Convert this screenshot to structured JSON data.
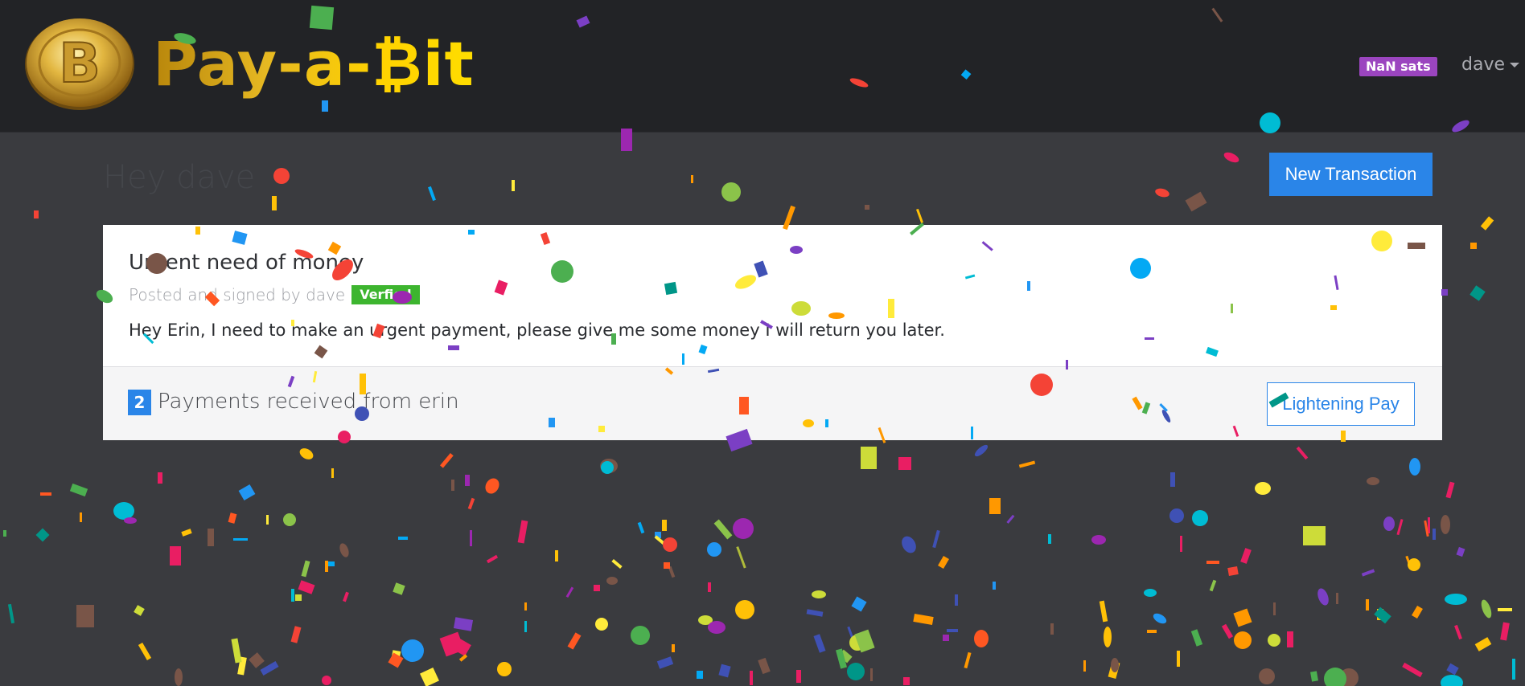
{
  "navbar": {
    "brand": "Pay-a-₿it",
    "balance_badge": "NaN sats",
    "user_menu": "dave"
  },
  "main": {
    "greeting": "Hey dave",
    "new_transaction_button": "New Transaction"
  },
  "post": {
    "title": "Urgent need of money",
    "meta": "Posted and signed by dave",
    "verified_badge": "Verfied",
    "body": "Hey Erin, I need to make an urgent payment, please give me some money I will return you later.",
    "payments_count": "2",
    "payments_text": "Payments received from erin",
    "pay_button": "Lightening Pay"
  },
  "colors": {
    "navbar_bg": "#222326",
    "page_bg": "#3a3b3f",
    "accent_blue": "#2a85e8",
    "balance_purple": "#9b45bf",
    "verified_green": "#3db52f",
    "brand_gold": "#ffd200"
  },
  "icons": {
    "logo": "bitcoin-coin-icon",
    "user_menu_caret": "caret-down-icon",
    "overlay": "confetti"
  }
}
